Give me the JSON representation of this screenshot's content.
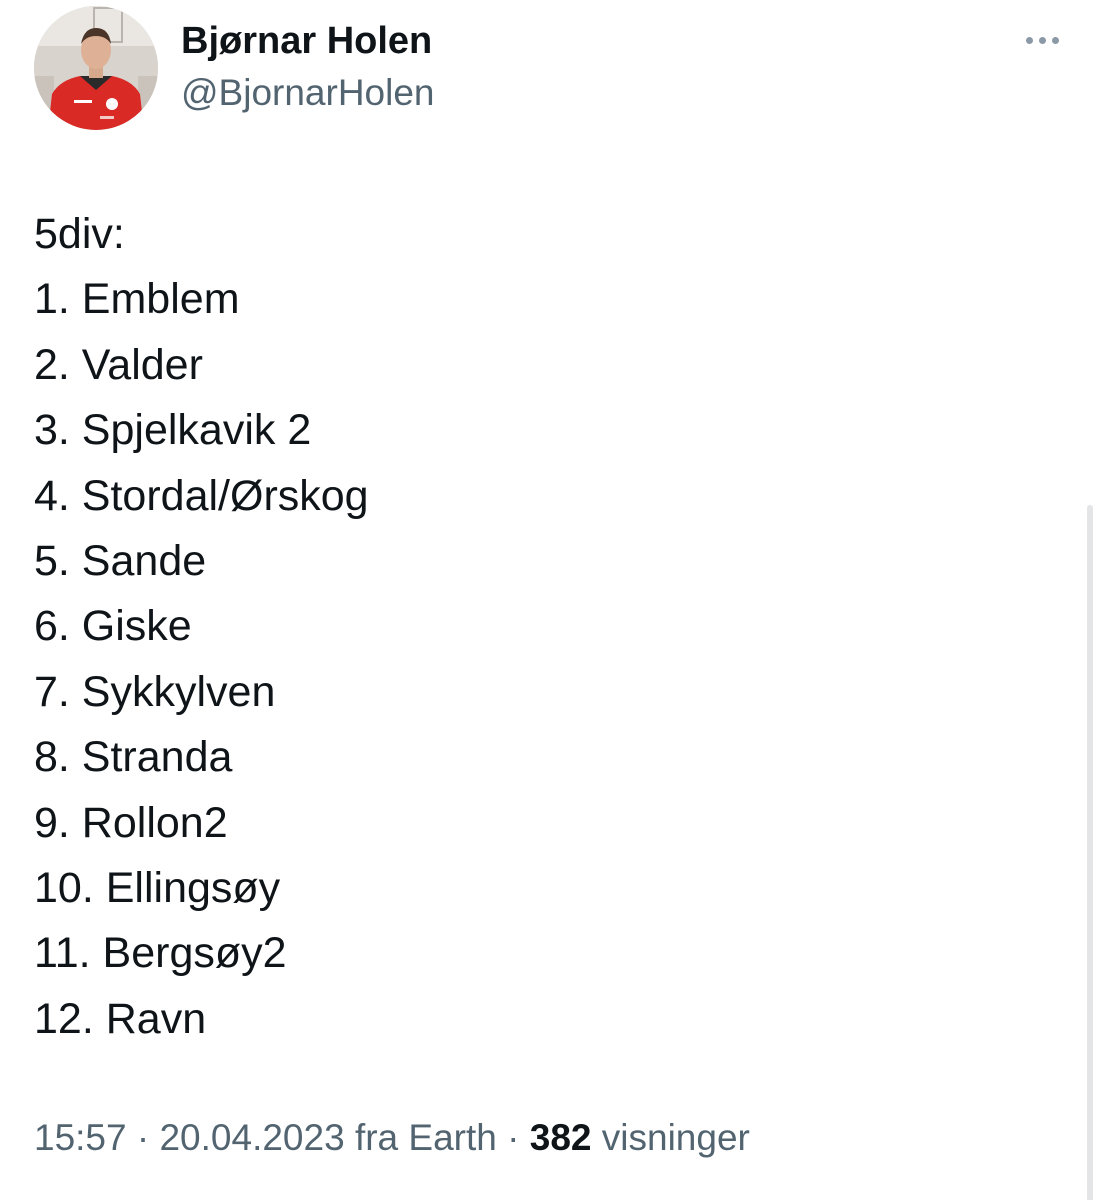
{
  "author": {
    "display_name": "Bjørnar Holen",
    "handle": "@BjornarHolen"
  },
  "tweet": {
    "lines": [
      "5div:",
      "1. Emblem",
      "2. Valder",
      "3. Spjelkavik 2",
      "4. Stordal/Ørskog",
      "5. Sande",
      "6. Giske",
      "7. Sykkylven",
      "8. Stranda",
      "9. Rollon2",
      "10. Ellingsøy",
      "11. Bergsøy2",
      "12. Ravn"
    ]
  },
  "meta": {
    "time": "15:57",
    "separator": " · ",
    "date": "20.04.2023",
    "source": "fra Earth",
    "views_count": "382",
    "views_label": "visninger"
  },
  "icons": {
    "more": "more-horizontal-icon"
  },
  "colors": {
    "text_primary": "#0f1419",
    "text_secondary": "#536471",
    "jersey_red": "#d92a26"
  }
}
